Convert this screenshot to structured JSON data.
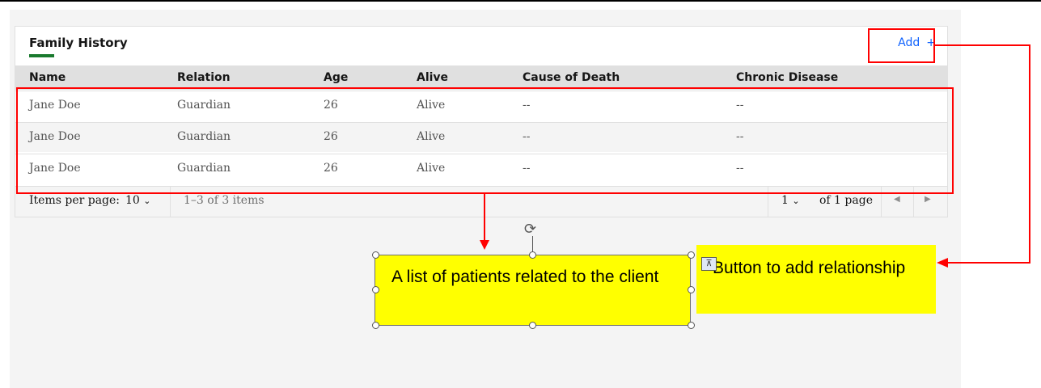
{
  "panel": {
    "title": "Family History",
    "add_label": "Add",
    "add_icon": "+"
  },
  "table": {
    "columns": [
      "Name",
      "Relation",
      "Age",
      "Alive",
      "Cause of Death",
      "Chronic Disease"
    ],
    "rows": [
      [
        "Jane Doe",
        "Guardian",
        "26",
        "Alive",
        "--",
        "--"
      ],
      [
        "Jane Doe",
        "Guardian",
        "26",
        "Alive",
        "--",
        "--"
      ],
      [
        "Jane Doe",
        "Guardian",
        "26",
        "Alive",
        "--",
        "--"
      ]
    ]
  },
  "pagination": {
    "items_per_page_label": "Items per page:",
    "items_per_page_value": "10",
    "range_text": "1–3 of 3 items",
    "page_value": "1",
    "page_total_text": "of 1 page",
    "chevron_icon": "chevron-down-icon",
    "prev_icon": "caret-left-icon",
    "next_icon": "caret-right-icon"
  },
  "annotations": {
    "callout_list": "A list of patients related to the client",
    "callout_add": "Button to add relationship",
    "highlight_color": "#ffff00",
    "marker_color": "#ff0000"
  }
}
